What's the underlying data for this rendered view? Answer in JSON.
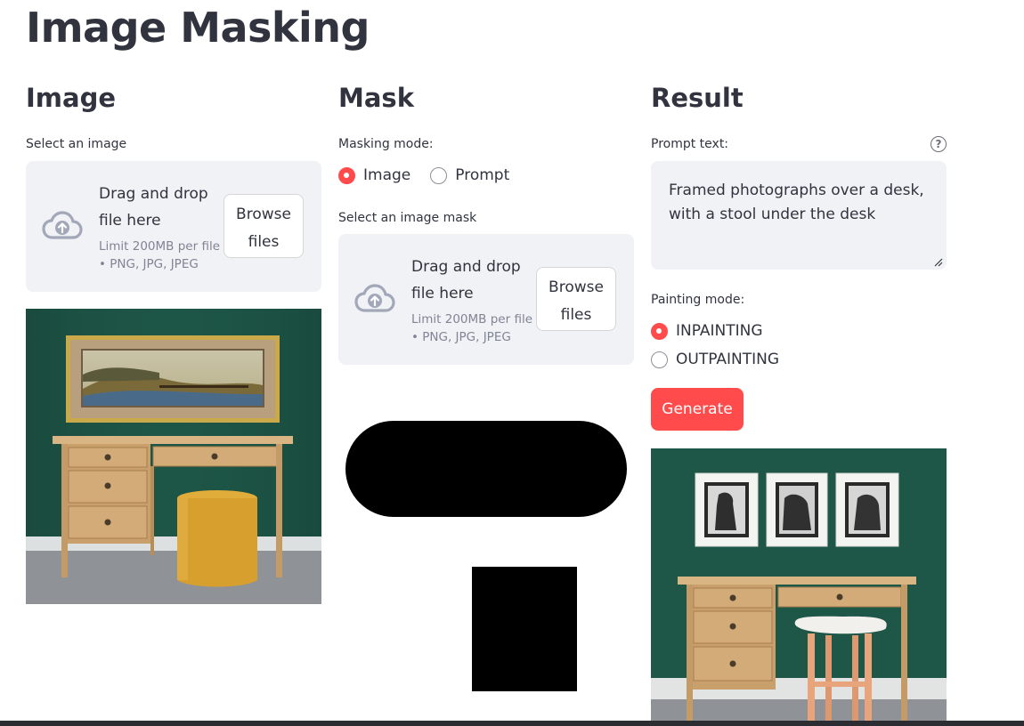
{
  "page": {
    "title": "Image Masking"
  },
  "image_col": {
    "heading": "Image",
    "select_label": "Select an image",
    "uploader": {
      "drag_drop": "Drag and drop file here",
      "limit": "Limit 200MB per file",
      "types": "• PNG, JPG, JPEG",
      "browse": "Browse files"
    }
  },
  "mask_col": {
    "heading": "Mask",
    "mode_label": "Masking mode:",
    "modes": [
      {
        "label": "Image",
        "selected": true
      },
      {
        "label": "Prompt",
        "selected": false
      }
    ],
    "select_label": "Select an image mask",
    "uploader": {
      "drag_drop": "Drag and drop file here",
      "limit": "Limit 200MB per file",
      "types": "• PNG, JPG, JPEG",
      "browse": "Browse files"
    }
  },
  "result_col": {
    "heading": "Result",
    "prompt_label": "Prompt text:",
    "prompt_value": "Framed photographs over a desk, with a stool under the desk",
    "painting_label": "Painting mode:",
    "painting_modes": [
      {
        "label": "INPAINTING",
        "selected": true
      },
      {
        "label": "OUTPAINTING",
        "selected": false
      }
    ],
    "generate": "Generate"
  },
  "colors": {
    "accent": "#ff4b4b",
    "wall_green": "#1d5546",
    "panel_bg": "#f0f2f6",
    "text": "#31333f"
  },
  "icons": [
    "cloud-upload-icon",
    "help-circle-icon",
    "resize-handle-icon"
  ]
}
